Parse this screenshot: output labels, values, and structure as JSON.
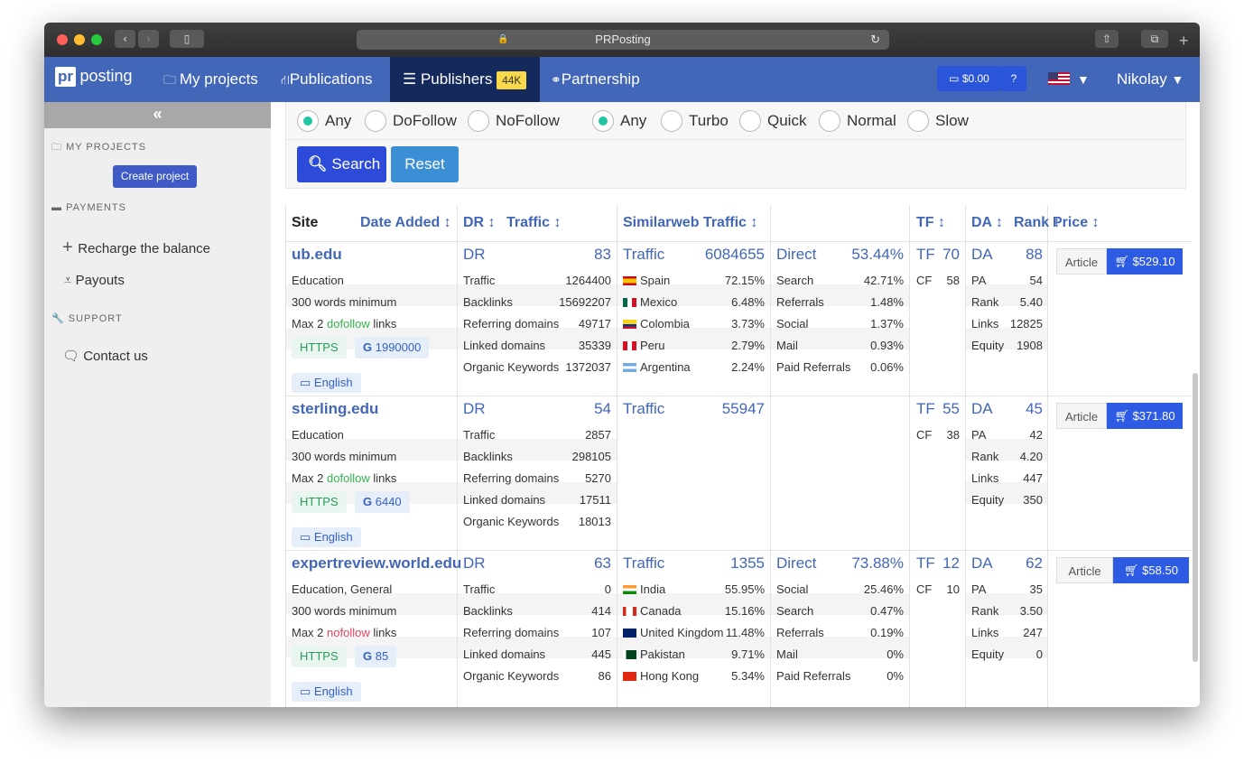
{
  "window": {
    "title": "PRPosting"
  },
  "topnav": {
    "logo_pr": "pr",
    "logo_text": "posting",
    "my_projects": "My projects",
    "publications": "Publications",
    "publishers": "Publishers",
    "publishers_badge": "44K",
    "partnership": "Partnership",
    "balance": "$0.00",
    "help": "?",
    "user": "Nikolay"
  },
  "sidebar": {
    "collapse": "«",
    "section_projects": "MY PROJECTS",
    "create_project": "Create project",
    "section_payments": "PAYMENTS",
    "recharge": "Recharge the balance",
    "payouts": "Payouts",
    "section_support": "SUPPORT",
    "contact": "Contact us"
  },
  "filters": {
    "link_any": "Any",
    "dofollow": "DoFollow",
    "nofollow": "NoFollow",
    "speed_any": "Any",
    "turbo": "Turbo",
    "quick": "Quick",
    "normal": "Normal",
    "slow": "Slow",
    "search": "Search",
    "reset": "Reset"
  },
  "table": {
    "headers": {
      "site": "Site",
      "date_added": "Date Added",
      "dr": "DR",
      "traffic": "Traffic",
      "similarweb": "Similarweb Traffic",
      "tf": "TF",
      "da": "DA",
      "rank": "Rank",
      "price": "Price"
    },
    "rows": [
      {
        "site": "ub.edu",
        "category": "Education",
        "words": "300 words minimum",
        "max_pre": "Max 2",
        "follow": "dofollow",
        "max_post": "links",
        "https": "HTTPS",
        "google": "1990000",
        "lang": "English",
        "dr_label": "DR",
        "dr": "83",
        "traffic_label": "Traffic",
        "traffic": "1264400",
        "backlinks_label": "Backlinks",
        "backlinks": "15692207",
        "refdom_label": "Referring domains",
        "refdom": "49717",
        "linked_label": "Linked domains",
        "linked": "35339",
        "org_label": "Organic Keywords",
        "org": "1372037",
        "sw_label": "Traffic",
        "sw_traffic": "6084655",
        "countries": [
          {
            "name": "Spain",
            "pct": "72.15%"
          },
          {
            "name": "Mexico",
            "pct": "6.48%"
          },
          {
            "name": "Colombia",
            "pct": "3.73%"
          },
          {
            "name": "Peru",
            "pct": "2.79%"
          },
          {
            "name": "Argentina",
            "pct": "2.24%"
          }
        ],
        "src_label": "Direct",
        "src_pct": "53.44%",
        "sources": [
          {
            "name": "Search",
            "pct": "42.71%"
          },
          {
            "name": "Referrals",
            "pct": "1.48%"
          },
          {
            "name": "Social",
            "pct": "1.37%"
          },
          {
            "name": "Mail",
            "pct": "0.93%"
          },
          {
            "name": "Paid Referrals",
            "pct": "0.06%"
          }
        ],
        "tf_label": "TF",
        "tf": "70",
        "cf_label": "CF",
        "cf": "58",
        "da_label": "DA",
        "da": "88",
        "pa_label": "PA",
        "pa": "54",
        "rank_label": "Rank",
        "rank": "5.40",
        "links_label": "Links",
        "links": "12825",
        "equity_label": "Equity",
        "equity": "1908",
        "article": "Article",
        "price": "$529.10"
      },
      {
        "site": "sterling.edu",
        "category": "Education",
        "words": "300 words minimum",
        "max_pre": "Max 2",
        "follow": "dofollow",
        "max_post": "links",
        "https": "HTTPS",
        "google": "6440",
        "lang": "English",
        "dr_label": "DR",
        "dr": "54",
        "traffic_label": "Traffic",
        "traffic": "2857",
        "backlinks_label": "Backlinks",
        "backlinks": "298105",
        "refdom_label": "Referring domains",
        "refdom": "5270",
        "linked_label": "Linked domains",
        "linked": "17511",
        "org_label": "Organic Keywords",
        "org": "18013",
        "sw_label": "Traffic",
        "sw_traffic": "55947",
        "countries": [],
        "src_label": "",
        "src_pct": "",
        "sources": [],
        "tf_label": "TF",
        "tf": "55",
        "cf_label": "CF",
        "cf": "38",
        "da_label": "DA",
        "da": "45",
        "pa_label": "PA",
        "pa": "42",
        "rank_label": "Rank",
        "rank": "4.20",
        "links_label": "Links",
        "links": "447",
        "equity_label": "Equity",
        "equity": "350",
        "article": "Article",
        "price": "$371.80"
      },
      {
        "site": "expertreview.world.edu",
        "category": "Education, General",
        "words": "300 words minimum",
        "max_pre": "Max 2",
        "follow": "nofollow",
        "max_post": "links",
        "https": "HTTPS",
        "google": "85",
        "lang": "English",
        "dr_label": "DR",
        "dr": "63",
        "traffic_label": "Traffic",
        "traffic": "0",
        "backlinks_label": "Backlinks",
        "backlinks": "414",
        "refdom_label": "Referring domains",
        "refdom": "107",
        "linked_label": "Linked domains",
        "linked": "445",
        "org_label": "Organic Keywords",
        "org": "86",
        "sw_label": "Traffic",
        "sw_traffic": "1355",
        "countries": [
          {
            "name": "India",
            "pct": "55.95%"
          },
          {
            "name": "Canada",
            "pct": "15.16%"
          },
          {
            "name": "United Kingdom",
            "pct": "11.48%"
          },
          {
            "name": "Pakistan",
            "pct": "9.71%"
          },
          {
            "name": "Hong Kong",
            "pct": "5.34%"
          }
        ],
        "src_label": "Direct",
        "src_pct": "73.88%",
        "sources": [
          {
            "name": "Social",
            "pct": "25.46%"
          },
          {
            "name": "Search",
            "pct": "0.47%"
          },
          {
            "name": "Referrals",
            "pct": "0.19%"
          },
          {
            "name": "Mail",
            "pct": "0%"
          },
          {
            "name": "Paid Referrals",
            "pct": "0%"
          }
        ],
        "tf_label": "TF",
        "tf": "12",
        "cf_label": "CF",
        "cf": "10",
        "da_label": "DA",
        "da": "62",
        "pa_label": "PA",
        "pa": "35",
        "rank_label": "Rank",
        "rank": "3.50",
        "links_label": "Links",
        "links": "247",
        "equity_label": "Equity",
        "equity": "0",
        "article": "Article",
        "price": "$58.50"
      }
    ]
  },
  "colors": {
    "accent": "#4266b8",
    "dark_nav": "#142a5c",
    "green": "#1fc6a4",
    "dofollow": "#2fb34a",
    "nofollow": "#e0435a",
    "buy": "#2d5be3"
  }
}
